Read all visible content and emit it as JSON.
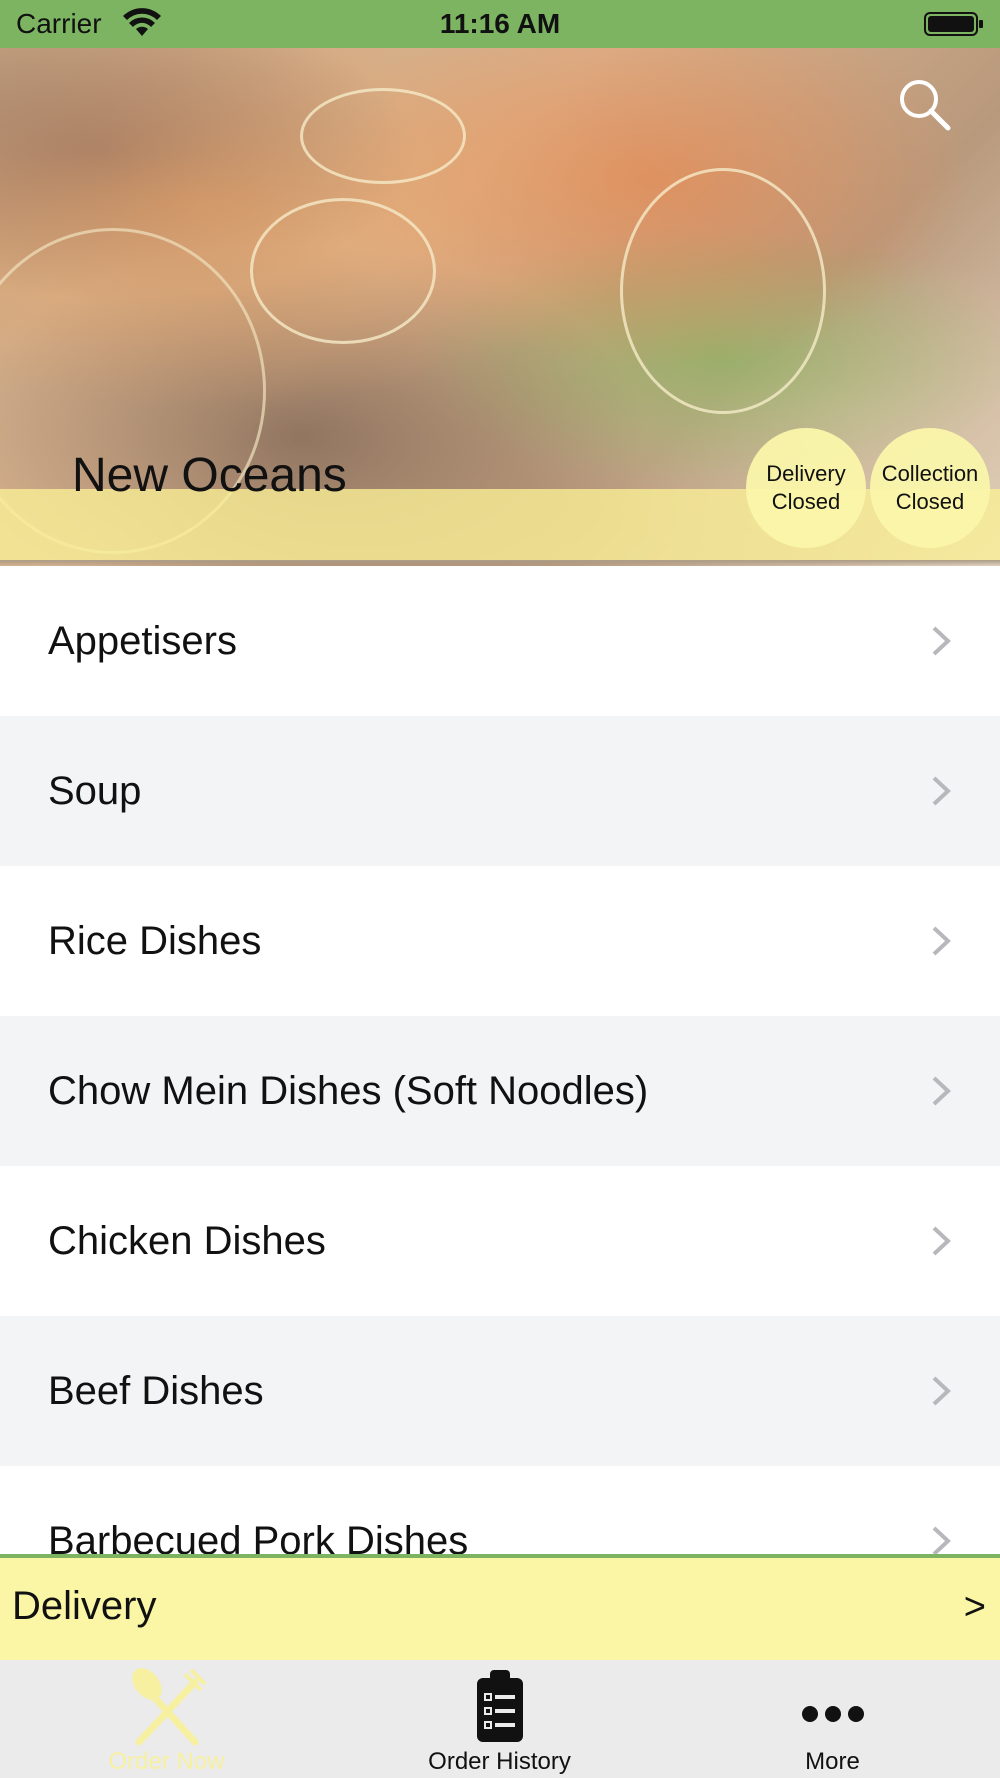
{
  "status_bar": {
    "carrier": "Carrier",
    "time": "11:16 AM"
  },
  "header": {
    "restaurant_name": "New Oceans",
    "delivery_status": {
      "line1": "Delivery",
      "line2": "Closed"
    },
    "collection_status": {
      "line1": "Collection",
      "line2": "Closed"
    }
  },
  "menu": {
    "categories": [
      {
        "label": "Appetisers"
      },
      {
        "label": "Soup"
      },
      {
        "label": "Rice Dishes"
      },
      {
        "label": "Chow Mein Dishes (Soft Noodles)"
      },
      {
        "label": "Chicken Dishes"
      },
      {
        "label": "Beef Dishes"
      },
      {
        "label": "Barbecued Pork Dishes"
      }
    ]
  },
  "order_mode": {
    "label": "Delivery",
    "arrow": ">"
  },
  "tab_bar": {
    "tabs": [
      {
        "label": "Order Now",
        "icon": "fork-knife-icon",
        "active": true
      },
      {
        "label": "Order History",
        "icon": "clipboard-list-icon",
        "active": false
      },
      {
        "label": "More",
        "icon": "more-dots-icon",
        "active": false
      }
    ]
  },
  "colors": {
    "brand_green": "#7cb462",
    "highlight_yellow": "#fbf6a6",
    "active_tab": "#f6f0a0"
  }
}
